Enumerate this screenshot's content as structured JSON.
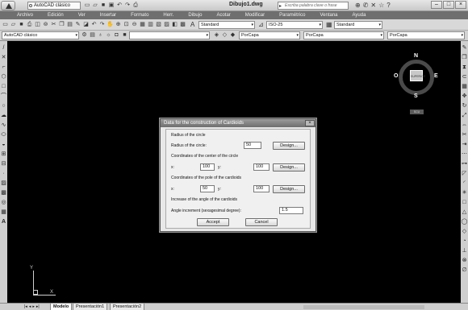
{
  "window": {
    "workspace": "AutoCAD clásico",
    "doc_title": "Dibujo1.dwg",
    "search_placeholder": "Escriba palabra clave o frase",
    "help_label": "?"
  },
  "menu": [
    "Archivo",
    "Edición",
    "Ver",
    "Insertar",
    "Formato",
    "Herr.",
    "Dibujo",
    "Acotar",
    "Modificar",
    "Paramétrico",
    "Ventana",
    "Ayuda"
  ],
  "toolbar": {
    "text_style": "Standard",
    "dim_style": "ISO-25",
    "table_style": "Standard"
  },
  "properties_bar": {
    "workspace": "AutoCAD clásico",
    "layer": "PorCapa",
    "linetype": "PorCapa",
    "lineweight": "PorCapa"
  },
  "viewcube": {
    "north": "N",
    "south": "S",
    "west": "O",
    "east": "E",
    "face": "SUPERIOR",
    "wcs": "SCU"
  },
  "ucs": {
    "x": "X",
    "y": "Y"
  },
  "layout_tabs": [
    "Modelo",
    "Presentación1",
    "Presentación2"
  ],
  "dialog": {
    "title": "Data for the construction of Cardioids",
    "radius_header": "Radius of the circle",
    "radius_label": "Radius of the circle:",
    "radius_value": "50",
    "design_label": "Design...",
    "center_header": "Coordinates of the center of the circle",
    "x_label": "x:",
    "y_label": "y:",
    "center_x": "100",
    "center_y": "100",
    "pole_header": "Coordinates of the pole of the cardioids",
    "pole_x": "50",
    "pole_y": "100",
    "angle_header": "Increase of the angle of the cardioids",
    "angle_label": "Angle increment (sexagesimal degree):",
    "angle_value": "1.5",
    "accept_label": "Accept",
    "cancel_label": "Cancel"
  }
}
